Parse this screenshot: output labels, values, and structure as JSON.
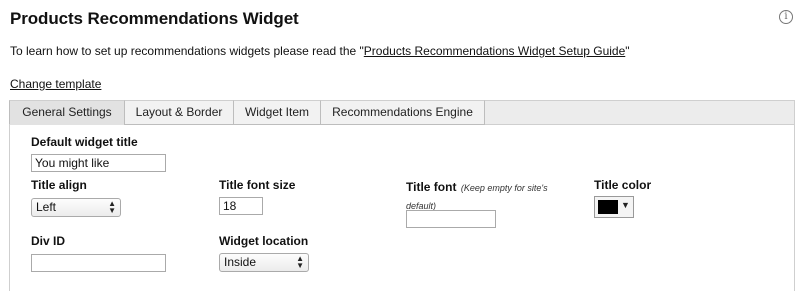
{
  "header": {
    "title": "Products Recommendations Widget",
    "info_icon": "info-icon"
  },
  "intro": {
    "prefix": "To learn how to set up recommendations widgets please read the \"",
    "link": "Products Recommendations Widget Setup Guide",
    "suffix": "\""
  },
  "change_template": "Change template",
  "tabs": [
    {
      "label": "General Settings",
      "active": true
    },
    {
      "label": "Layout & Border",
      "active": false
    },
    {
      "label": "Widget Item",
      "active": false
    },
    {
      "label": "Recommendations Engine",
      "active": false
    }
  ],
  "form": {
    "default_title": {
      "label": "Default widget title",
      "value": "You might like"
    },
    "title_align": {
      "label": "Title align",
      "value": "Left"
    },
    "title_font_size": {
      "label": "Title font size",
      "value": "18"
    },
    "title_font": {
      "label": "Title font",
      "hint": "(Keep empty for site's default)",
      "value": ""
    },
    "title_color": {
      "label": "Title color",
      "value": "#000000"
    },
    "div_id": {
      "label": "Div ID",
      "value": ""
    },
    "widget_location": {
      "label": "Widget location",
      "value": "Inside"
    }
  }
}
